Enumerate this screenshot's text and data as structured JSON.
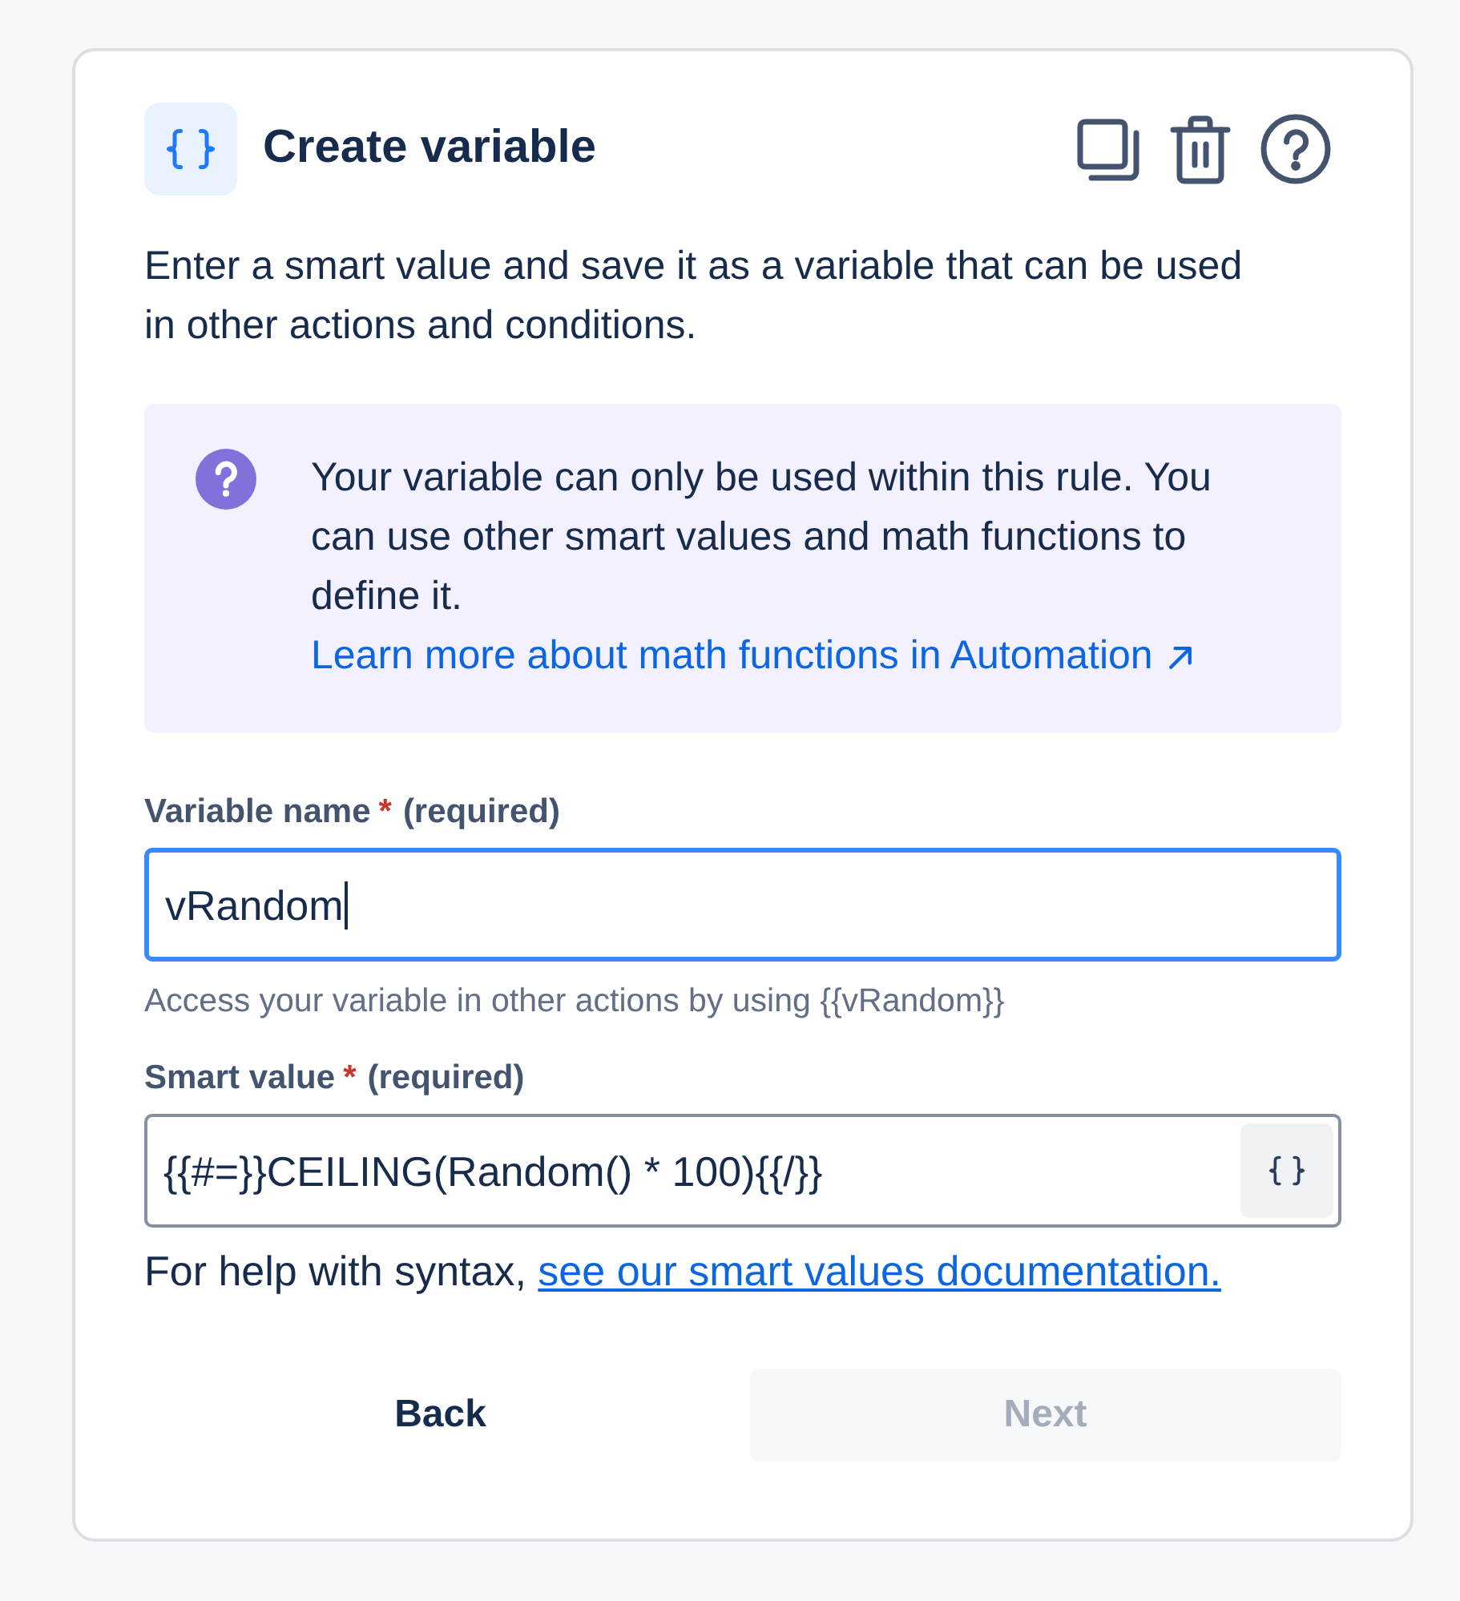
{
  "dialog": {
    "title": "Create variable",
    "description": "Enter a smart value and save it as a variable that can be used in other actions and conditions."
  },
  "info_panel": {
    "text": "Your variable can only be used within this rule. You can use other smart values and math functions to define it.",
    "link": "Learn more about math functions in Automation"
  },
  "fields": [
    {
      "kind": "text",
      "label": "Variable name",
      "required_mark": "*",
      "required_note": "(required)",
      "value": "vRandom",
      "focused": true,
      "helper": "Access your variable in other actions by using {{vRandom}}"
    },
    {
      "kind": "smart",
      "label": "Smart value",
      "required_mark": "*",
      "required_note": "(required)",
      "value": "{{#=}}CEILING(Random() * 100){{/}}",
      "focused": false,
      "helper": "For help with syntax,",
      "helper_link": "see our smart values documentation."
    }
  ],
  "buttons": [
    {
      "kind": "subtle",
      "label": "Back",
      "disabled": false
    },
    {
      "kind": "primary",
      "label": "Next",
      "disabled": true
    }
  ]
}
